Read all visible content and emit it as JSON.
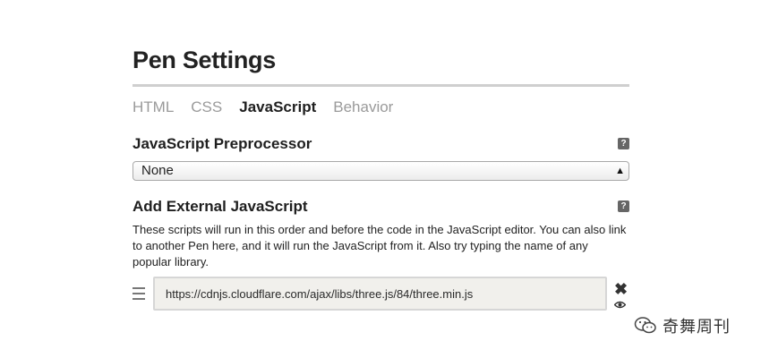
{
  "settings": {
    "title": "Pen Settings",
    "tabs": [
      {
        "label": "HTML",
        "active": false
      },
      {
        "label": "CSS",
        "active": false
      },
      {
        "label": "JavaScript",
        "active": true
      },
      {
        "label": "Behavior",
        "active": false
      }
    ],
    "preprocessor": {
      "label": "JavaScript Preprocessor",
      "help": "?",
      "selected": "None"
    },
    "external": {
      "label": "Add External JavaScript",
      "help": "?",
      "description": "These scripts will run in this order and before the code in the JavaScript editor. You can also link to another Pen here, and it will run the JavaScript from it. Also try typing the name of any popular library.",
      "url_value": "https://cdnjs.cloudflare.com/ajax/libs/three.js/84/three.min.js",
      "remove_label": "✖"
    }
  },
  "watermark": {
    "text": "奇舞周刊"
  },
  "colors": {
    "help_bg": "#666666",
    "input_bg": "#f1f0ec",
    "rule": "#cfcfcf"
  }
}
